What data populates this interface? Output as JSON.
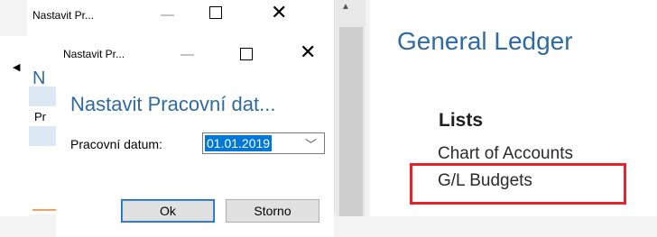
{
  "general_ledger": {
    "title": "General Ledger",
    "lists_heading": "Lists",
    "items": [
      "Chart of Accounts",
      "G/L Budgets"
    ],
    "highlight_color": "#e8232b"
  },
  "back_window": {
    "title": "Nastavit Pr...",
    "partial_heading": "N",
    "partial_label": "Pr"
  },
  "dialog": {
    "title": "Nastavit Pr...",
    "heading": "Nastavit Pracovní dat...",
    "field_label": "Pracovní datum:",
    "date_value": "01.01.2019",
    "ok_label": "Ok",
    "cancel_label": "Storno"
  },
  "colors": {
    "accent_blue": "#2f6aa3",
    "selection_blue": "#0078d7"
  }
}
